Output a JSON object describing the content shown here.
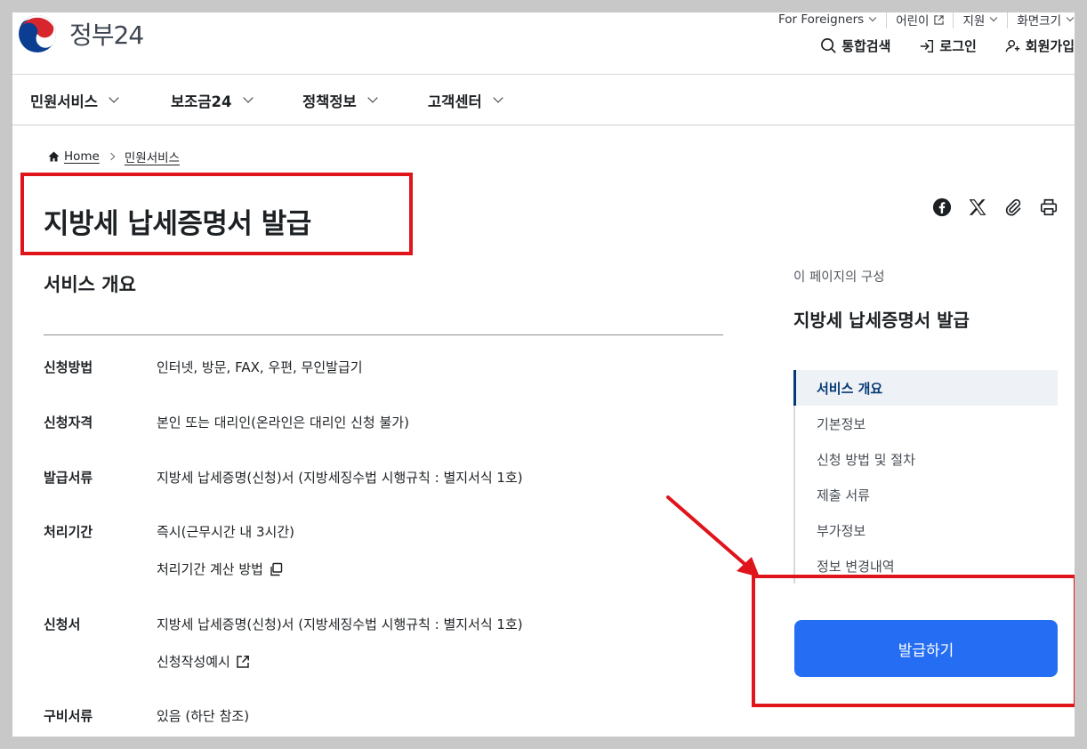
{
  "header": {
    "logo_text": "정부24",
    "util_links": [
      {
        "label": "For Foreigners",
        "type": "dropdown"
      },
      {
        "label": "어린이",
        "type": "external"
      },
      {
        "label": "지원",
        "type": "dropdown"
      },
      {
        "label": "화면크기",
        "type": "dropdown"
      }
    ],
    "member_links": [
      {
        "label": "통합검색",
        "icon": "search-icon"
      },
      {
        "label": "로그인",
        "icon": "login-icon"
      },
      {
        "label": "회원가입",
        "icon": "user-plus-icon"
      }
    ]
  },
  "gnb": {
    "items": [
      {
        "label": "민원서비스"
      },
      {
        "label": "보조금24"
      },
      {
        "label": "정책정보"
      },
      {
        "label": "고객센터"
      }
    ]
  },
  "breadcrumb": {
    "home": "Home",
    "current": "민원서비스"
  },
  "page": {
    "title": "지방세 납세증명서 발급",
    "share_icons": [
      "facebook-icon",
      "x-icon",
      "link-icon",
      "print-icon"
    ]
  },
  "overview": {
    "title": "서비스 개요",
    "rows": [
      {
        "label": "신청방법",
        "value": "인터넷, 방문, FAX, 우편, 무인발급기"
      },
      {
        "label": "신청자격",
        "value": "본인 또는 대리인(온라인은 대리인 신청 불가)"
      },
      {
        "label": "발급서류",
        "value": "지방세 납세증명(신청)서 (지방세징수법 시행규칙 : 별지서식 1호)"
      },
      {
        "label": "처리기간",
        "value": "즉시(근무시간 내 3시간)",
        "sub": "처리기간 계산 방법"
      },
      {
        "label": "신청서",
        "value": "지방세 납세증명(신청)서 (지방세징수법 시행규칙 : 별지서식 1호)",
        "sub": "신청작성예시"
      },
      {
        "label": "구비서류",
        "value": "있음 (하단 참조)"
      }
    ]
  },
  "aside": {
    "caption": "이 페이지의 구성",
    "title": "지방세 납세증명서 발급",
    "toc": [
      {
        "label": "서비스 개요",
        "active": true
      },
      {
        "label": "기본정보"
      },
      {
        "label": "신청 방법 및 절차"
      },
      {
        "label": "제출 서류"
      },
      {
        "label": "부가정보"
      },
      {
        "label": "정보 변경내역"
      }
    ],
    "issue_button": "발급하기"
  },
  "colors": {
    "primary": "#256ef4",
    "active_text": "#063a74",
    "highlight": "#e0141b"
  }
}
